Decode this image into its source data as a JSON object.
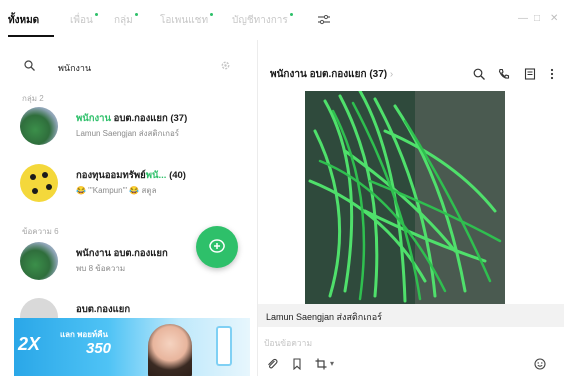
{
  "tabs": [
    {
      "label": "ทั้งหมด",
      "active": true,
      "dot": false
    },
    {
      "label": "เพื่อน",
      "active": false,
      "dot": true
    },
    {
      "label": "กลุ่ม",
      "active": false,
      "dot": true
    },
    {
      "label": "โอเพนแชท",
      "active": false,
      "dot": true
    },
    {
      "label": "บัญชีทางการ",
      "active": false,
      "dot": true
    }
  ],
  "search": {
    "query": "พนักงาน"
  },
  "sections": {
    "groups": "กลุ่ม 2",
    "messages": "ข้อความ 6"
  },
  "chats": [
    {
      "name_hl": "พนักงาน",
      "name_rest": " อบต.กองแยก",
      "count": "(37)",
      "preview": "Lamun Saengjan ส่งสติกเกอร์"
    },
    {
      "name_prefix": "กองทุนออมทรัพย์",
      "name_hl": "พนั...",
      "count": "(40)",
      "preview": "😂 '''Kampun''' 😂 สตูล"
    },
    {
      "name": "พนักงาน อบต.กองแยก",
      "preview": "พบ 8 ข้อความ"
    },
    {
      "name": "อบต.กองแยก"
    }
  ],
  "banner": {
    "tag": "2X",
    "line1": "แลก พอยท์คืน",
    "amount": "350"
  },
  "chat": {
    "title": "พนักงาน อบต.กองแยก",
    "count": "(37)",
    "caption": "Lamun Saengjan ส่งสติกเกอร์",
    "composer_placeholder": "ป้อนข้อความ"
  },
  "colors": {
    "accent": "#2ec06a",
    "tab_inactive": "#c8c8c8",
    "caption_bg": "#f2f2f2"
  }
}
